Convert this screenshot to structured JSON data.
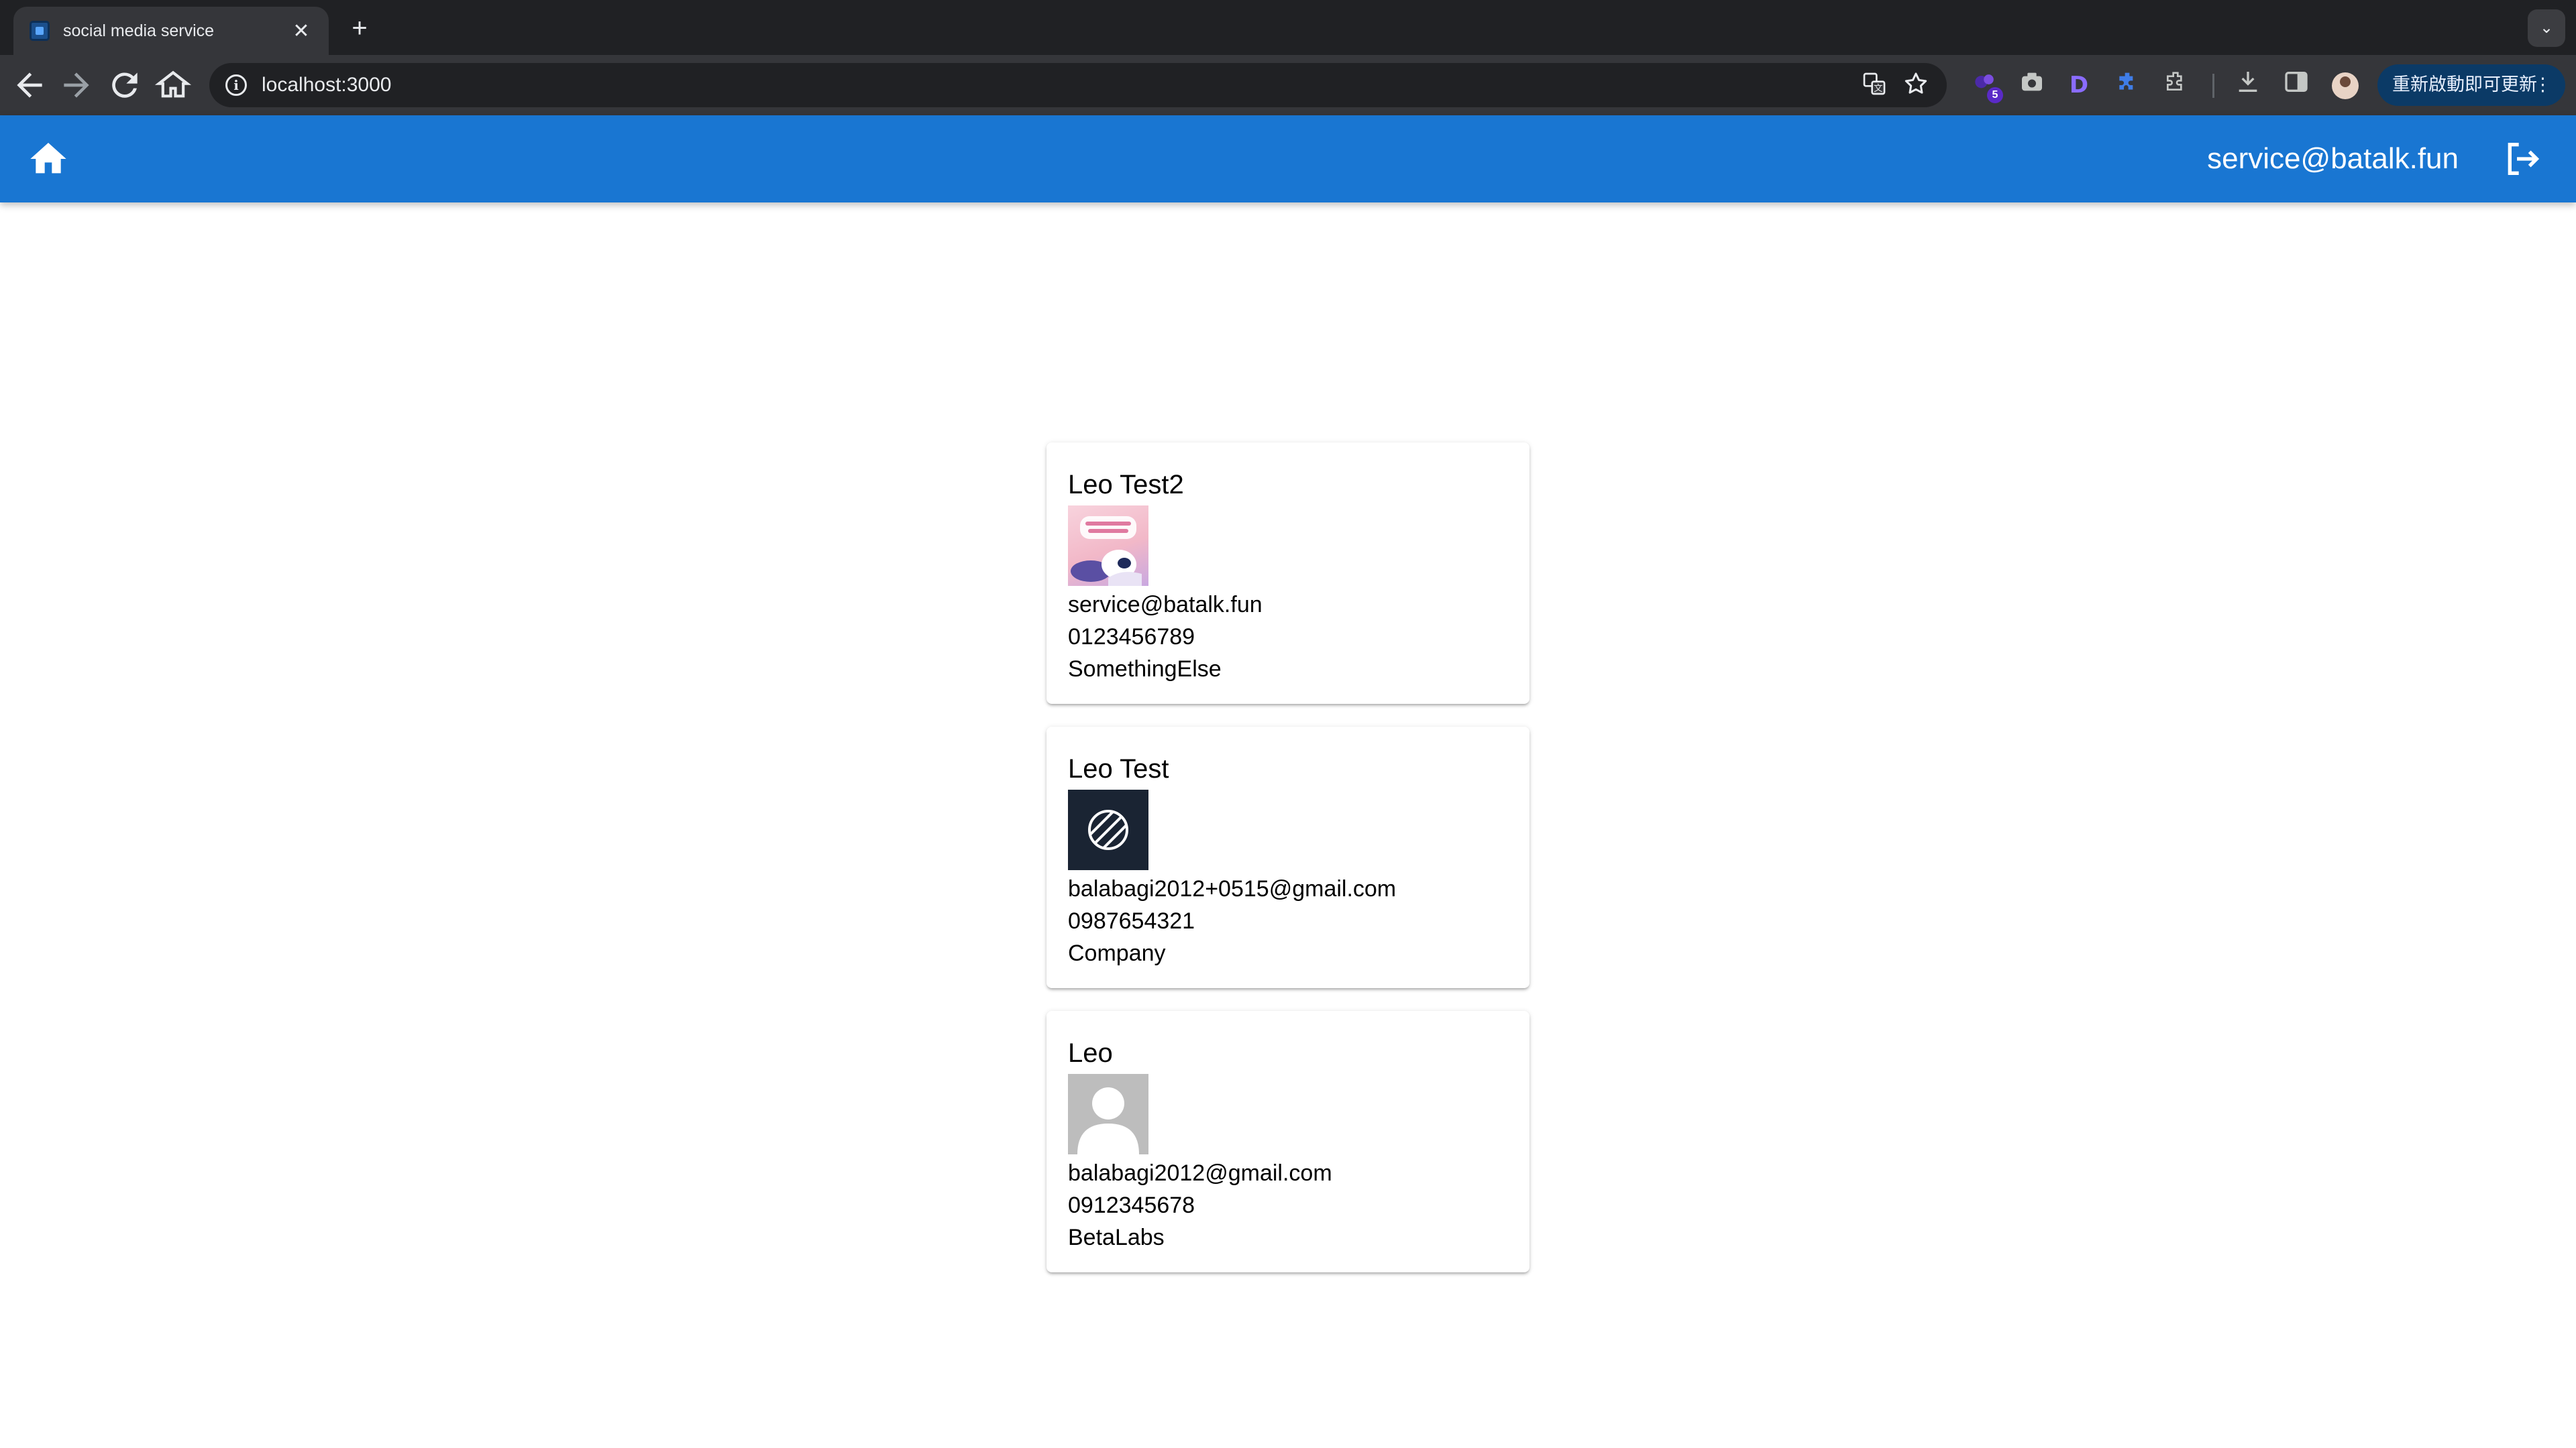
{
  "browser": {
    "tab_title": "social media service",
    "tab_close": "✕",
    "new_tab": "+",
    "tab_search": "⌄",
    "url": "localhost:3000",
    "update_label": "重新啟動即可更新",
    "extension_badge": "5",
    "extension_d": "D"
  },
  "appbar": {
    "user_email": "service@batalk.fun",
    "bar_color": "#1976d2"
  },
  "users": [
    {
      "name": "Leo Test2",
      "avatar_icon": "custom-image-icon",
      "email": "service@batalk.fun",
      "phone": "0123456789",
      "company": "SomethingElse"
    },
    {
      "name": "Leo Test",
      "avatar_icon": "striped-circle-logo-icon",
      "email": "balabagi2012+0515@gmail.com",
      "phone": "0987654321",
      "company": "Company"
    },
    {
      "name": "Leo",
      "avatar_icon": "default-person-icon",
      "email": "balabagi2012@gmail.com",
      "phone": "0912345678",
      "company": "BetaLabs"
    }
  ]
}
